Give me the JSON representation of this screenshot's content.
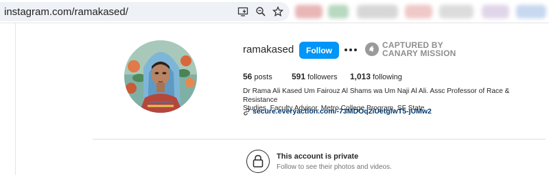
{
  "browser": {
    "url": "instagram.com/ramakased/",
    "icons": [
      "install-app-icon",
      "zoom-icon",
      "bookmark-star-icon"
    ]
  },
  "profile": {
    "username": "ramakased",
    "follow_label": "Follow",
    "more_icon": "more-options-icon",
    "watermark": {
      "line1": "CAPTURED BY",
      "line2": "CANARY MISSION"
    },
    "stats": {
      "posts_count": "56",
      "posts_label": "posts",
      "followers_count": "591",
      "followers_label": "followers",
      "following_count": "1,013",
      "following_label": "following"
    },
    "bio_line1": "Dr Rama Ali Kased Um Fairouz Al Shams wa Um Naji Al Ali. Assc Professor of Race & Resistance",
    "bio_line2": "Studies. Faculty Advisor, Metro College Program, SF State",
    "link": "secure.everyaction.com/-73MDOq2iUetglwT5-jUMw2"
  },
  "private_notice": {
    "title": "This account is private",
    "subtitle": "Follow to see their photos and videos."
  },
  "colors": {
    "follow_button": "#0095f6",
    "link": "#00376b",
    "watermark": "#8e8e8e"
  }
}
